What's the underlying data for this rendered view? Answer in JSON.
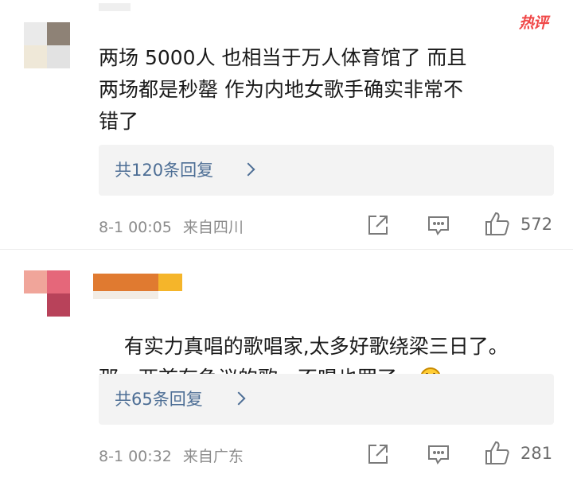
{
  "comments": [
    {
      "hot_badge": "热评",
      "text": "两场 5000人 也相当于万人体育馆了 而且\n两场都是秒罄 作为内地女歌手确实非常不\n错了",
      "reply_link": "共120条回复",
      "time": "8-1 00:05",
      "location": "来自四川",
      "likes": "572"
    },
    {
      "text": "有实力真唱的歌唱家,太多好歌绕梁三日了。\n那一两首有争议的歌，不唱也罢了。",
      "emoji": "laughing-emoji",
      "reply_link": "共65条回复",
      "time": "8-1 00:32",
      "location": "来自广东",
      "likes": "281"
    }
  ],
  "icons": {
    "share": "share-icon",
    "comment": "comment-icon",
    "like": "like-icon",
    "reply_arrow": "chevron-right-icon"
  },
  "colors": {
    "hot_badge": "#f04848",
    "link": "#4d6e95",
    "meta": "#8c8c8c",
    "reply_bg": "#f3f3f3"
  }
}
